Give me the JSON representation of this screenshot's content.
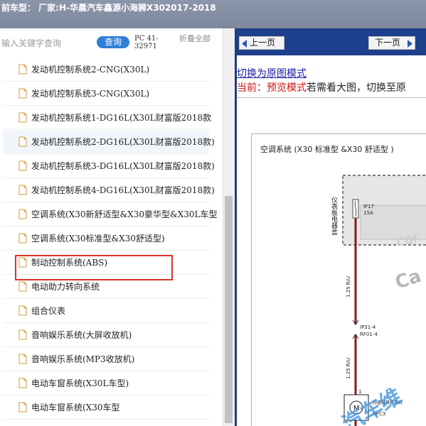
{
  "window": {
    "title": "前车型：  厂家:H-华晨汽车鑫源小海狮X302017-2018"
  },
  "search": {
    "placeholder": "输入关键字查询",
    "button_label": "查询",
    "pc_code": "PC 41-32971",
    "collapse_label": "折叠全部"
  },
  "tree": {
    "items": [
      {
        "label": "发动机控制系统2-CNG(X30L)"
      },
      {
        "label": "发动机控制系统3-CNG(X30L)"
      },
      {
        "label": "发动机控制系统1-DG16L(X30L财富版2018款"
      },
      {
        "label": "发动机控制系统2-DG16L(X30L财富版2018款)"
      },
      {
        "label": "发动机控制系统3-DG16L(X30L财富版2018款)"
      },
      {
        "label": "发动机控制系统4-DG16L(X30L财富版2018款)"
      },
      {
        "label": "空调系统(X30新舒适型&X30豪华型&X30L车型"
      },
      {
        "label": "空调系统(X30标准型&X30舒适型)"
      },
      {
        "label": "制动控制系统(ABS)"
      },
      {
        "label": "电动助力转向系统"
      },
      {
        "label": "组合仪表"
      },
      {
        "label": "音响娱乐系统(大屏收放机)"
      },
      {
        "label": "音响娱乐系统(MP3收放机)"
      },
      {
        "label": "电动车窗系统(X30L车型)"
      },
      {
        "label": "电动车窗系统(X30车型"
      }
    ],
    "selected_index": 7
  },
  "viewer": {
    "prev_label": "上一页",
    "next_label": "下一页",
    "mode_link": "切换为原图模式",
    "current_prefix": "当前：",
    "current_mode": "预览模式",
    "hint": "若需看大图，切换至原"
  },
  "diagram": {
    "title": "空调系统 (X30 标准型 &X30 舒适型 )",
    "panel_label": "仪表板电器盒",
    "fuse_id": "IF17",
    "fuse_rating": "15A",
    "wire1_spec": "1.25 R/U",
    "connector1": "IP31-4",
    "connector2": "RF01-4",
    "wire2_spec": "1.25 R/U",
    "pin_no": "1",
    "motor_symbol": "M",
    "motor_name": "顶盖鼓风机电机",
    "motor_code": "RFC3",
    "watermark1": "car",
    "watermark2": "Ca",
    "watermark3": "汽车维"
  },
  "colors": {
    "titlebar": "#8c96aa",
    "nav_bar": "#1d3f8c",
    "query_button": "#2f7fd6",
    "selected_border": "#d9342b",
    "wire_red": "#8b1a1a",
    "watermark_blue": "#3a8fd8"
  }
}
